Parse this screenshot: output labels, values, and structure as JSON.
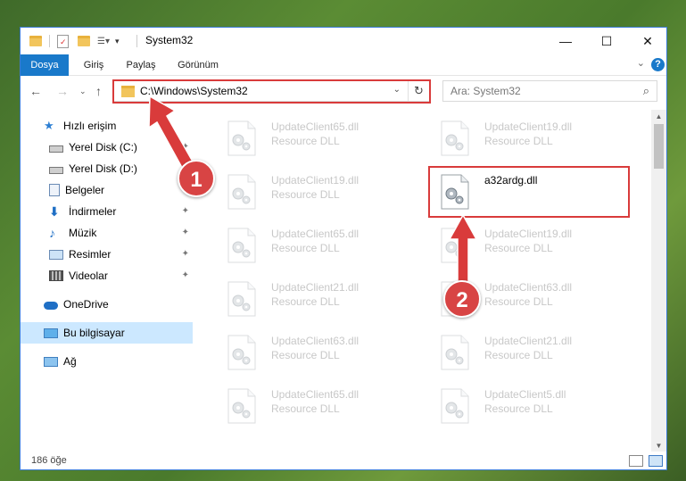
{
  "window": {
    "title": "System32",
    "controls": {
      "minimize": "—",
      "maximize": "☐",
      "close": "✕"
    }
  },
  "ribbon": {
    "tabs": [
      "Dosya",
      "Giriş",
      "Paylaş",
      "Görünüm"
    ],
    "help": "?"
  },
  "nav": {
    "address": "C:\\Windows\\System32",
    "search_placeholder": "Ara: System32"
  },
  "sidebar": {
    "items": [
      {
        "label": "Hızlı erişim",
        "icon": "star-icon"
      },
      {
        "label": "Yerel Disk (C:)",
        "icon": "drive-icon"
      },
      {
        "label": "Yerel Disk (D:)",
        "icon": "drive-icon"
      },
      {
        "label": "Belgeler",
        "icon": "documents-icon"
      },
      {
        "label": "İndirmeler",
        "icon": "download-icon"
      },
      {
        "label": "Müzik",
        "icon": "music-icon"
      },
      {
        "label": "Resimler",
        "icon": "pictures-icon"
      },
      {
        "label": "Videolar",
        "icon": "videos-icon"
      },
      {
        "label": "OneDrive",
        "icon": "cloud-icon"
      },
      {
        "label": "Bu bilgisayar",
        "icon": "computer-icon"
      },
      {
        "label": "Ağ",
        "icon": "network-icon"
      }
    ]
  },
  "files": [
    {
      "name": "UpdateClient65.dll",
      "type": "Resource DLL"
    },
    {
      "name": "UpdateClient19.dll",
      "type": "Resource DLL"
    },
    {
      "name": "UpdateClient19.dll",
      "type": "Resource DLL"
    },
    {
      "name": "a32ardg.dll",
      "type": ""
    },
    {
      "name": "UpdateClient65.dll",
      "type": "Resource DLL"
    },
    {
      "name": "UpdateClient19.dll",
      "type": "Resource DLL"
    },
    {
      "name": "UpdateClient21.dll",
      "type": "Resource DLL"
    },
    {
      "name": "UpdateClient63.dll",
      "type": "Resource DLL"
    },
    {
      "name": "UpdateClient63.dll",
      "type": "Resource DLL"
    },
    {
      "name": "UpdateClient21.dll",
      "type": "Resource DLL"
    },
    {
      "name": "UpdateClient65.dll",
      "type": "Resource DLL"
    },
    {
      "name": "UpdateClient5.dll",
      "type": "Resource DLL"
    }
  ],
  "status": {
    "count": "186 öğe"
  },
  "annotations": {
    "step1": "1",
    "step2": "2",
    "color": "#d93b3b"
  }
}
